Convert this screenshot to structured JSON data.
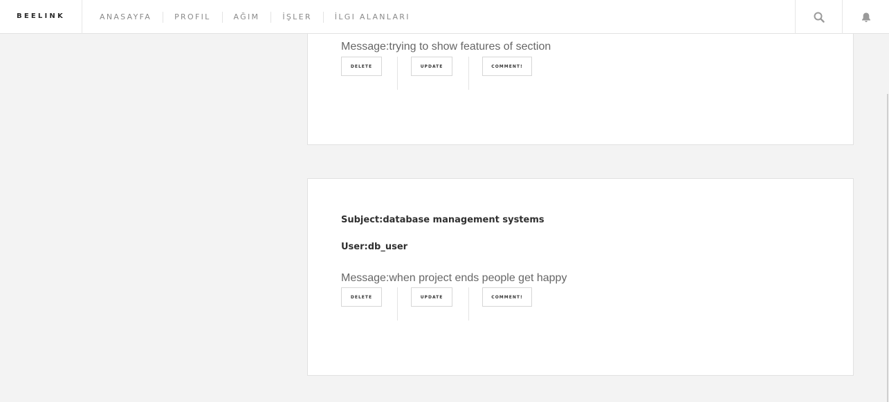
{
  "brand": "BEELINK",
  "nav": {
    "items": [
      "ANASAYFA",
      "PROFIL",
      "AĞIM",
      "İŞLER",
      "İLGI ALANLARI"
    ]
  },
  "header_icons": {
    "search": "search-icon",
    "notifications": "bell-icon"
  },
  "posts": [
    {
      "message": "Message:trying to show features of section",
      "actions": {
        "delete": "DELETE",
        "update": "UPDATE",
        "comment": "COMMENT!"
      }
    },
    {
      "subject": "Subject:database management systems",
      "user": "User:db_user",
      "message": "Message:when project ends people get happy",
      "actions": {
        "delete": "DELETE",
        "update": "UPDATE",
        "comment": "COMMENT!"
      }
    }
  ],
  "colors": {
    "background": "#f3f3f3",
    "card": "#ffffff",
    "text": "#2f2f2f",
    "muted": "#8a8a8a"
  }
}
